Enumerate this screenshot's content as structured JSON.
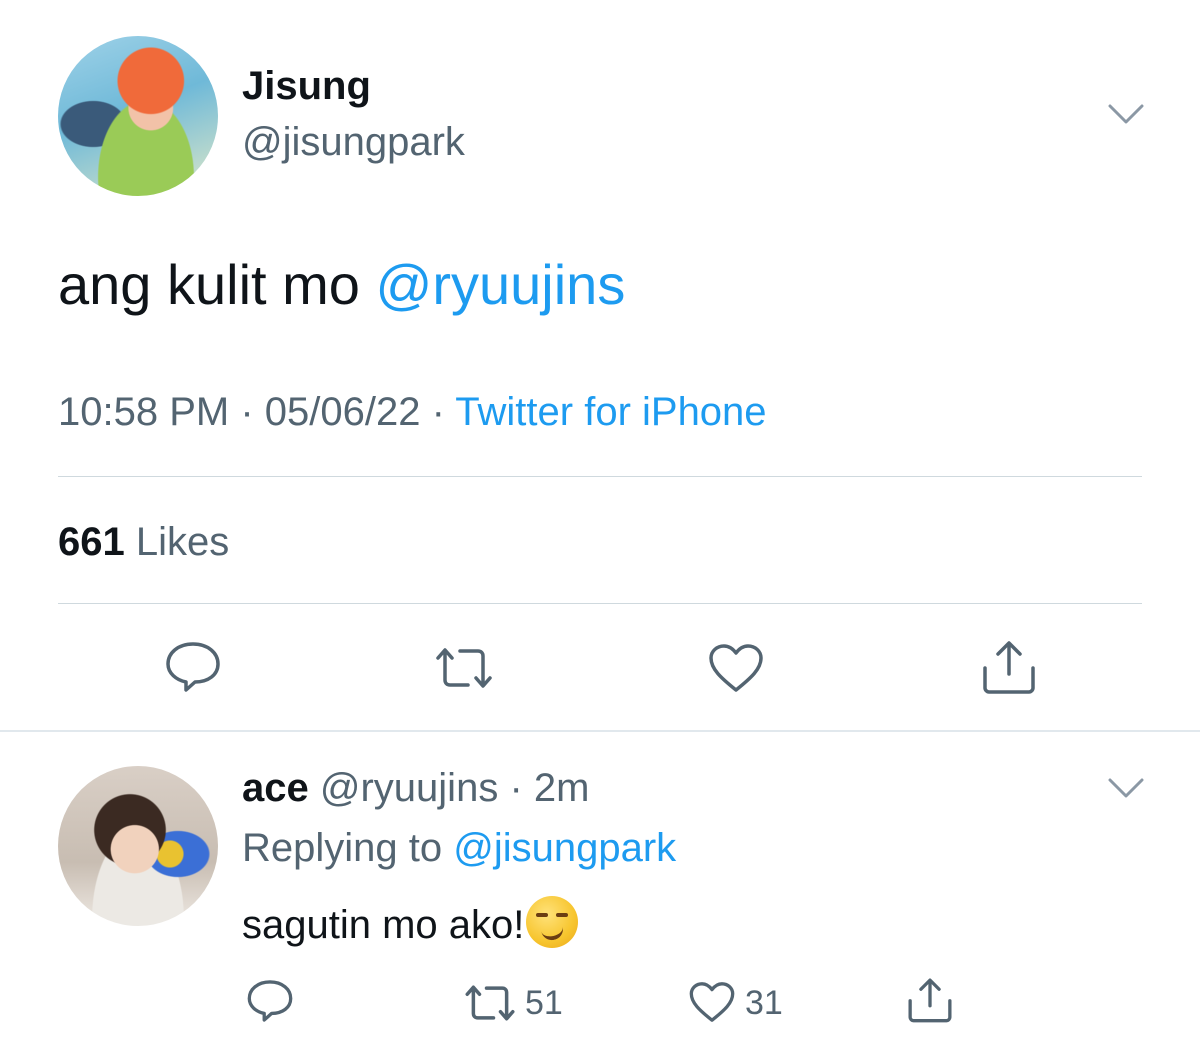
{
  "tweet": {
    "author_name": "Jisung",
    "author_handle": "@jisungpark",
    "text_prefix": "ang kulit mo ",
    "text_mention": "@ryuujins",
    "time": "10:58 PM",
    "date": "05/06/22",
    "source": "Twitter for iPhone",
    "meta_sep": " · ",
    "likes_count": "661",
    "likes_label": "Likes"
  },
  "reply": {
    "author_name": "ace",
    "author_handle": "@ryuujins",
    "age": "2m",
    "dot": "·",
    "replying_prefix": "Replying to ",
    "replying_handle": "@jisungpark",
    "text": "sagutin mo ako!",
    "emoji": "smirking-face-emoji",
    "retweet_count": "51",
    "like_count": "31"
  },
  "colors": {
    "accent": "#1d9bf0",
    "secondary_text": "#536471",
    "primary_text": "#0f1419",
    "divider": "#cfd9de"
  }
}
